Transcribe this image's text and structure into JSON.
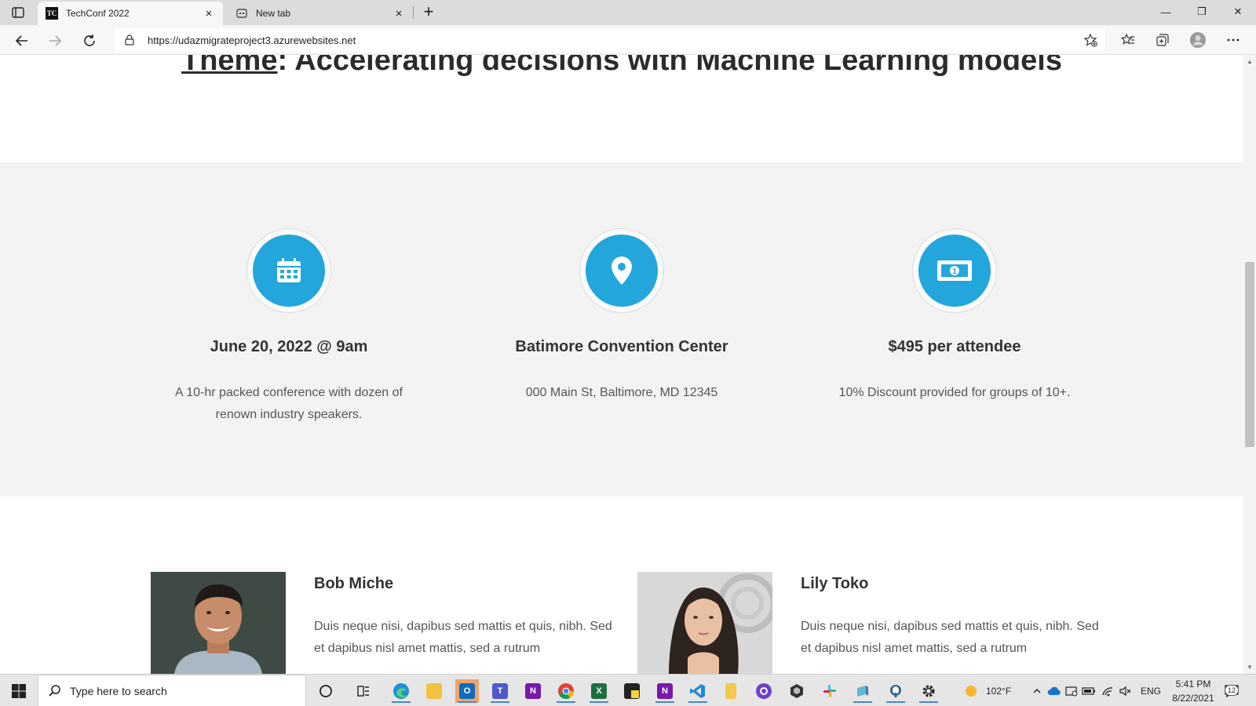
{
  "browser": {
    "tabs": [
      {
        "label": "TechConf 2022",
        "favicon": "TC",
        "active": true
      },
      {
        "label": "New tab",
        "favicon": "newtab-icon",
        "active": false
      }
    ],
    "url": "https://udazmigrateproject3.azurewebsites.net",
    "window_controls": {
      "minimize": "—",
      "restore": "❐",
      "close": "✕"
    }
  },
  "page": {
    "theme_word": "Theme",
    "theme_rest": ": Accelerating decisions with Machine Learning models",
    "features": [
      {
        "icon": "calendar-icon",
        "title": "June 20, 2022 @ 9am",
        "desc": "A 10-hr packed conference with dozen of renown industry speakers."
      },
      {
        "icon": "map-pin-icon",
        "title": "Batimore Convention Center",
        "desc": "000 Main St, Baltimore, MD 12345"
      },
      {
        "icon": "money-icon",
        "title": "$495 per attendee",
        "desc": "10% Discount provided for groups of 10+."
      }
    ],
    "speakers": [
      {
        "name": "Bob Miche",
        "bio": "Duis neque nisi, dapibus sed mattis et quis, nibh. Sed et dapibus nisl amet mattis, sed a rutrum"
      },
      {
        "name": "Lily Toko",
        "bio": "Duis neque nisi, dapibus sed mattis et quis, nibh. Sed et dapibus nisl amet mattis, sed a rutrum"
      }
    ],
    "accent_color": "#22a6dc"
  },
  "taskbar": {
    "search_placeholder": "Type here to search",
    "weather": "102°F",
    "language": "ENG",
    "time": "5:41 PM",
    "date": "8/22/2021",
    "notification_count": "12"
  }
}
